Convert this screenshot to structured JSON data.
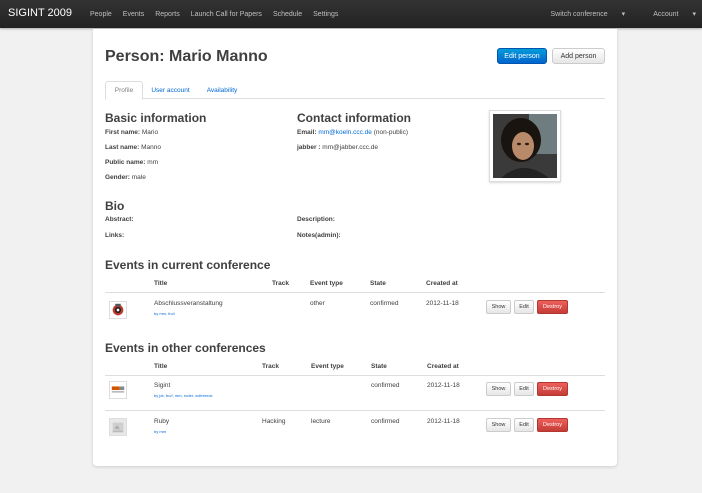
{
  "topbar": {
    "brand": "SIGINT 2009",
    "nav": [
      "People",
      "Events",
      "Reports",
      "Launch Call for Papers",
      "Schedule",
      "Settings"
    ],
    "switch_conference": "Switch conference",
    "account": "Account",
    "caret": "▾"
  },
  "page": {
    "title": "Person: Mario Manno",
    "edit_button": "Edit person",
    "add_button": "Add person"
  },
  "tabs": [
    "Profile",
    "User account",
    "Availability"
  ],
  "basic": {
    "heading": "Basic information",
    "first_name_label": "First name:",
    "first_name": "Mario",
    "last_name_label": "Last name:",
    "last_name": "Manno",
    "public_name_label": "Public name:",
    "public_name": "mm",
    "gender_label": "Gender:",
    "gender": "male"
  },
  "contact": {
    "heading": "Contact information",
    "email_label": "Email:",
    "email": "mm@koeln.ccc.de",
    "email_note": "(non-public)",
    "jabber_label": "jabber :",
    "jabber": "mm@jabber.ccc.de"
  },
  "bio": {
    "heading": "Bio",
    "abstract_label": "Abstract:",
    "links_label": "Links:",
    "description_label": "Description:",
    "notes_label": "Notes(admin):"
  },
  "current_events": {
    "heading": "Events in current conference",
    "headers": [
      "Title",
      "Track",
      "Event type",
      "State",
      "Created at"
    ],
    "rows": [
      {
        "title": "Abschlussveranstaltung",
        "by": "by mm, fro//",
        "track": "",
        "type": "other",
        "state": "confirmed",
        "created": "2012-11-18"
      }
    ]
  },
  "other_events": {
    "heading": "Events in other conferences",
    "headers": [
      "Title",
      "Track",
      "Event type",
      "State",
      "Created at"
    ],
    "rows": [
      {
        "title": "Sigint",
        "by": "by jdr, fro//, mm, roder, ocltrbreck",
        "track": "",
        "type": "",
        "state": "confirmed",
        "created": "2012-11-18"
      },
      {
        "title": "Ruby",
        "by": "by mm",
        "track": "Hacking",
        "type": "lecture",
        "state": "confirmed",
        "created": "2012-11-18"
      }
    ]
  },
  "row_buttons": {
    "show": "Show",
    "edit": "Edit",
    "destroy": "Destroy"
  }
}
